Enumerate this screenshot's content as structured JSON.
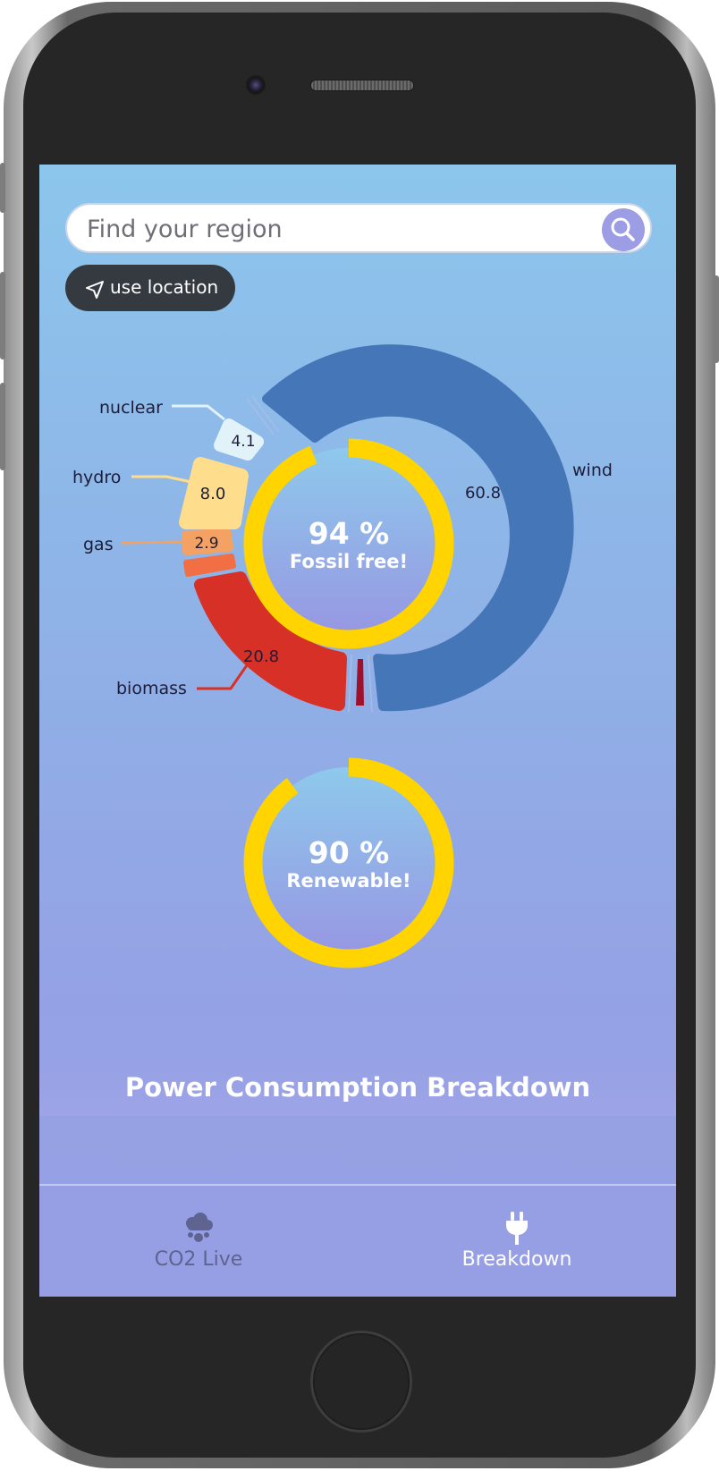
{
  "search": {
    "placeholder": "Find your region"
  },
  "location_button": {
    "label": "use location"
  },
  "fossil_free": {
    "percent_label": "94 %",
    "caption": "Fossil free!",
    "value": 0.94
  },
  "renewable": {
    "percent_label": "90 %",
    "caption": "Renewable!",
    "value": 0.9
  },
  "chart_data": {
    "type": "pie",
    "categories": [
      "wind",
      "biomass",
      "gas",
      "hydro",
      "nuclear"
    ],
    "labels": [
      {
        "name": "wind",
        "value": "60.8"
      },
      {
        "name": "biomass",
        "value": "20.8"
      },
      {
        "name": "gas",
        "value": "2.9"
      },
      {
        "name": "hydro",
        "value": "8.0"
      },
      {
        "name": "nuclear",
        "value": "4.1"
      }
    ],
    "values": [
      60.8,
      20.8,
      2.9,
      8.0,
      4.1
    ],
    "colors": {
      "wind": "#4576b8",
      "biomass": "#d63027",
      "gas": "#f4a263",
      "hydro": "#fedd8d",
      "nuclear": "#e1f2f8",
      "gauge": "#ffd400"
    }
  },
  "page_title": "Power Consumption Breakdown",
  "nav": {
    "items": [
      {
        "label": "CO2 Live",
        "icon": "cloud-icon",
        "active": false
      },
      {
        "label": "Breakdown",
        "icon": "plug-icon",
        "active": true
      }
    ]
  }
}
